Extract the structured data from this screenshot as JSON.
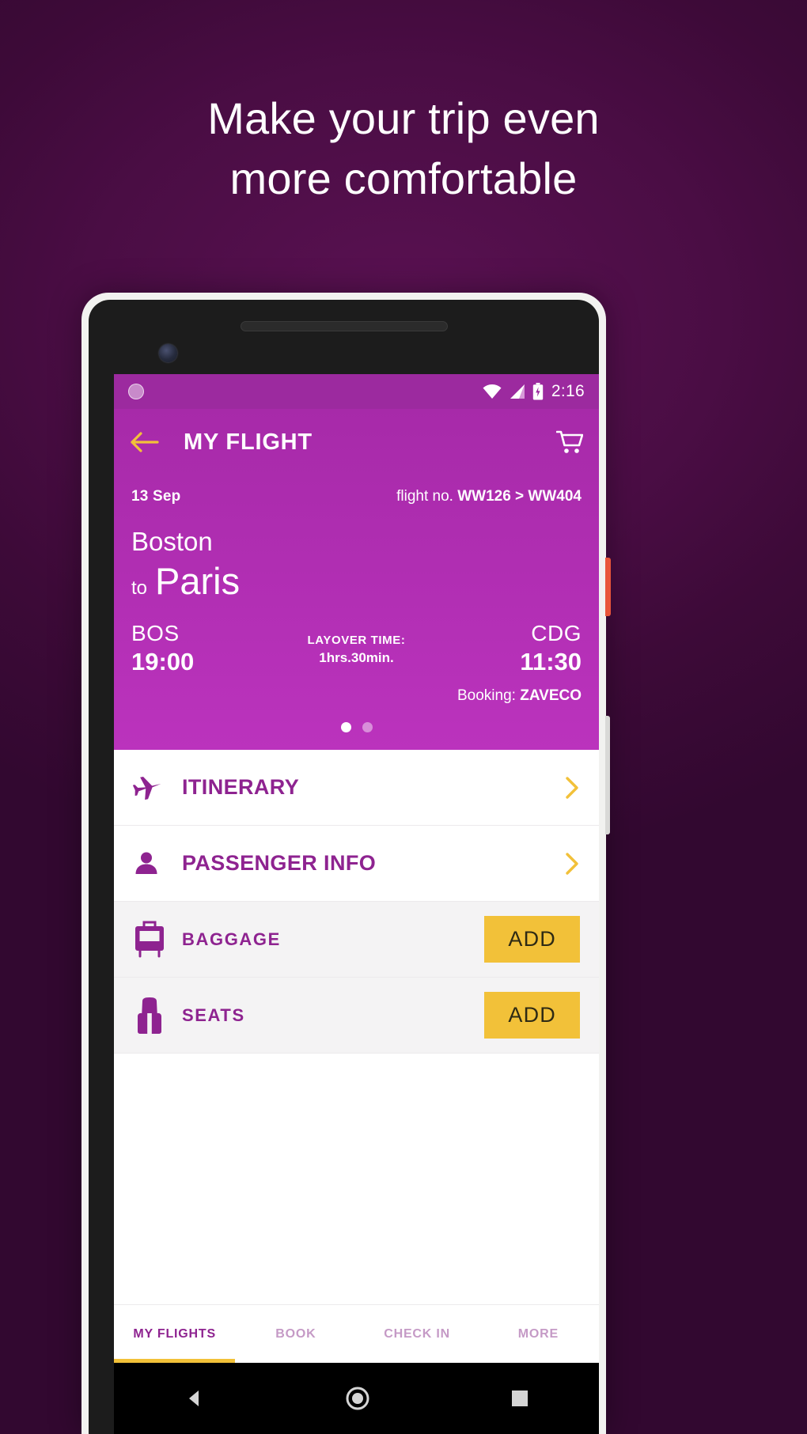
{
  "promo": {
    "headline_line1": "Make your trip even",
    "headline_line2": "more comfortable"
  },
  "statusbar": {
    "time": "2:16",
    "wifi_icon": "wifi-icon",
    "signal_icon": "cellular-signal-icon",
    "battery_icon": "battery-icon",
    "notification_dot": "notification-dot-icon"
  },
  "appbar": {
    "back_icon": "back-arrow-icon",
    "title": "MY FLIGHT",
    "cart_icon": "shopping-cart-icon"
  },
  "flight": {
    "date": "13 Sep",
    "flight_no_label": "flight no.",
    "flight_no_value": "WW126 > WW404",
    "origin_city": "Boston",
    "to_word": "to",
    "destination_city": "Paris",
    "origin_code": "BOS",
    "origin_time": "19:00",
    "destination_code": "CDG",
    "destination_time": "11:30",
    "layover_label": "LAYOVER TIME:",
    "layover_hours": "1hrs.",
    "layover_minutes": "30min.",
    "booking_label": "Booking:",
    "booking_code": "ZAVECO",
    "pager": {
      "total": 2,
      "active": 0
    }
  },
  "rows": [
    {
      "label": "ITINERARY",
      "icon": "airplane-icon",
      "style": "plain",
      "action": "chevron",
      "action_label": ""
    },
    {
      "label": "PASSENGER INFO",
      "icon": "person-icon",
      "style": "plain",
      "action": "chevron",
      "action_label": ""
    },
    {
      "label": "BAGGAGE",
      "icon": "suitcase-icon",
      "style": "shaded",
      "action": "button",
      "action_label": "ADD"
    },
    {
      "label": "SEATS",
      "icon": "seat-icon",
      "style": "shaded",
      "action": "button",
      "action_label": "ADD"
    }
  ],
  "tabs": [
    {
      "label": "MY FLIGHTS",
      "active": true
    },
    {
      "label": "BOOK",
      "active": false
    },
    {
      "label": "CHECK IN",
      "active": false
    },
    {
      "label": "MORE",
      "active": false
    }
  ],
  "navbar": {
    "back_icon": "android-back-icon",
    "home_icon": "android-home-icon",
    "recents_icon": "android-recents-icon"
  },
  "colors": {
    "brand_purple": "#9c2a9f",
    "card_purple": "#b530b7",
    "accent_yellow": "#f2c139",
    "label_purple": "#8e2390",
    "page_background": "#4a0d44"
  }
}
